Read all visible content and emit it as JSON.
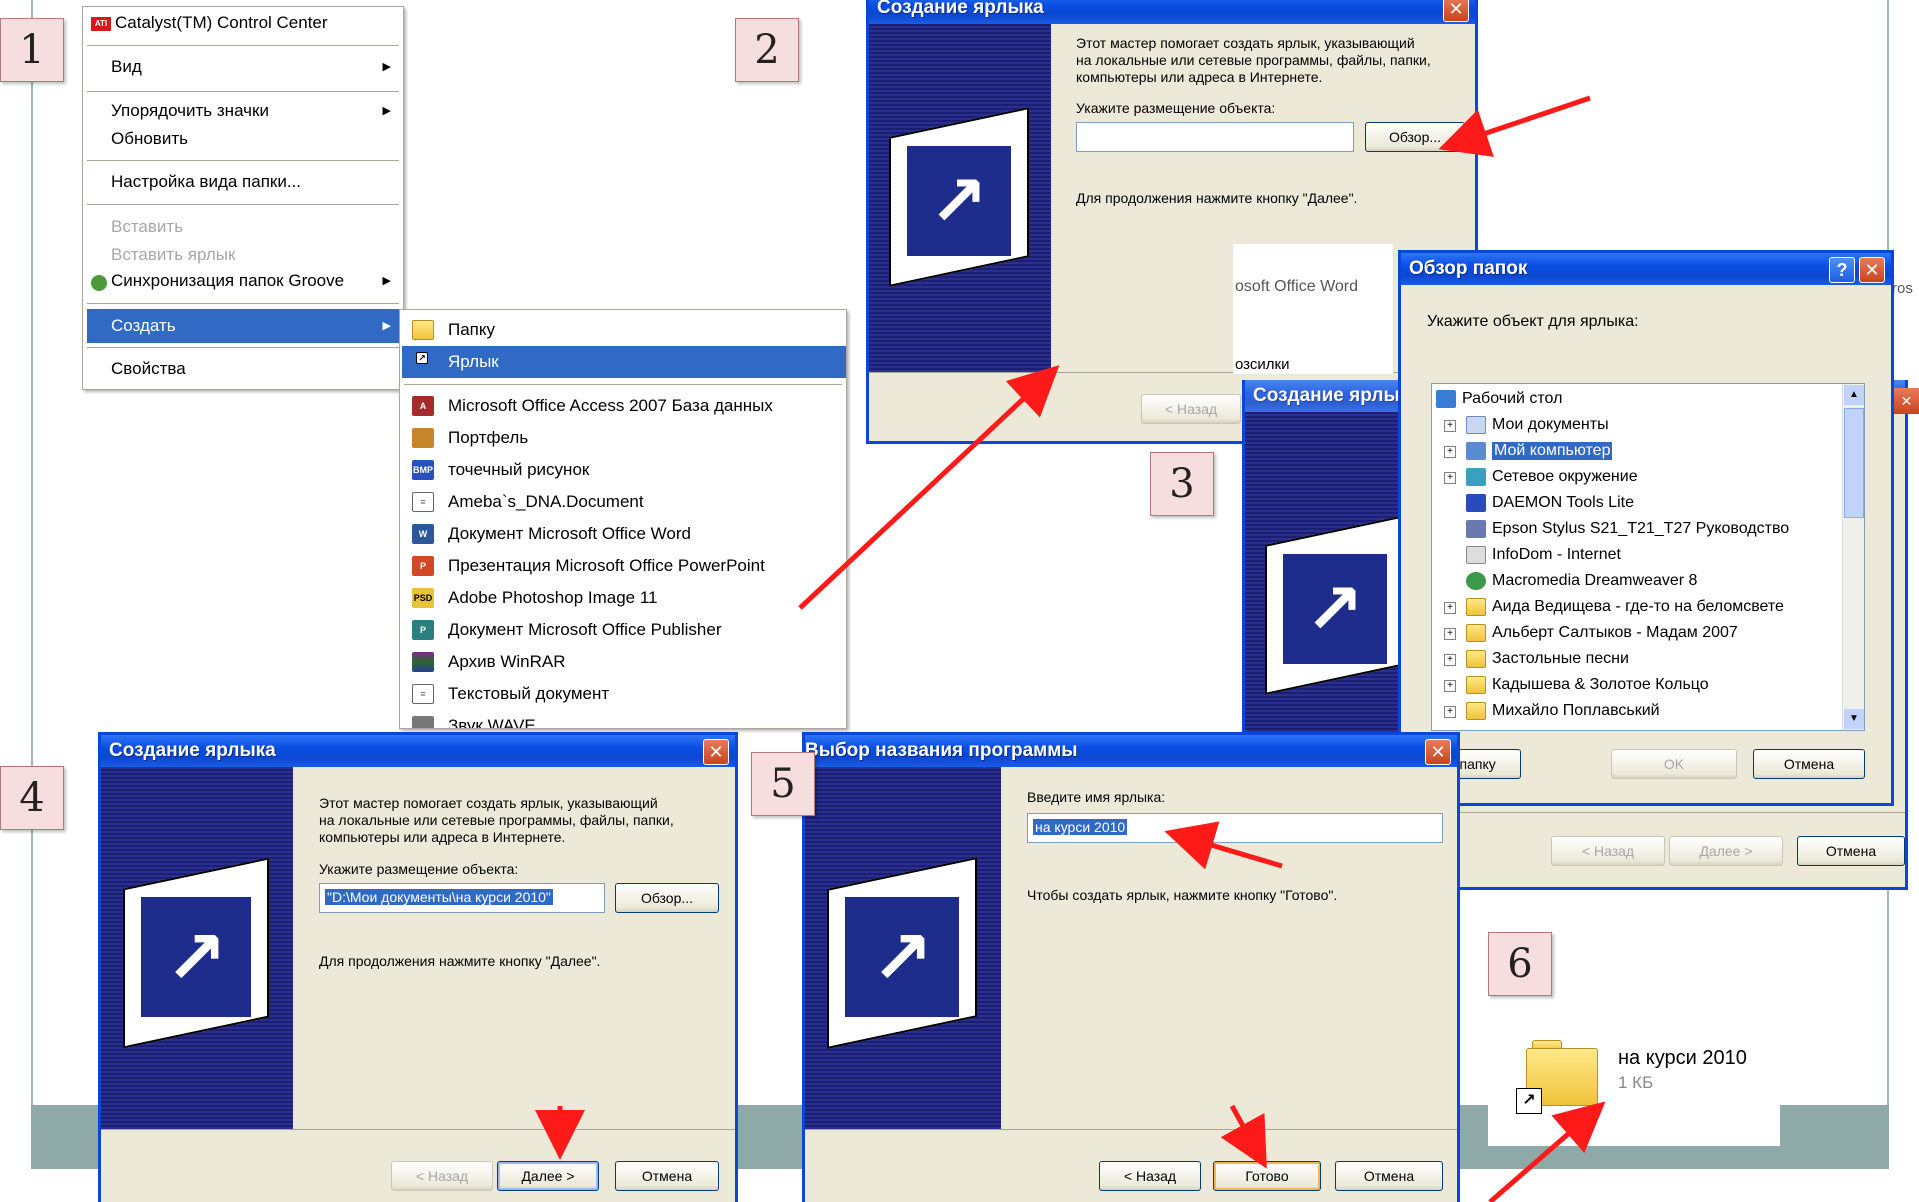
{
  "badges": [
    "1",
    "2",
    "3",
    "4",
    "5",
    "6"
  ],
  "context_menu": {
    "header_item": "Catalyst(TM) Control Center",
    "items": [
      "Вид",
      "Упорядочить значки",
      "Обновить",
      "Настройка вида папки...",
      "Вставить",
      "Вставить ярлык",
      "Синхронизация папок Groove",
      "Создать",
      "Свойства"
    ]
  },
  "create_submenu": {
    "items": [
      "Папку",
      "Ярлык",
      "Microsoft Office Access 2007 База данных",
      "Портфель",
      "точечный рисунок",
      "Ameba`s_DNA.Document",
      "Документ Microsoft Office Word",
      "Презентация Microsoft Office PowerPoint",
      "Adobe Photoshop Image 11",
      "Документ Microsoft Office Publisher",
      "Архив WinRAR",
      "Текстовый документ",
      "Звук WAVE"
    ]
  },
  "wizard_step2": {
    "title": "Создание ярлыка",
    "intro": [
      "Этот мастер помогает создать ярлык, указывающий",
      "на локальные или сетевые программы, файлы, папки,",
      "компьютеры или адреса в Интернете."
    ],
    "location_label": "Укажите размещение объекта:",
    "location_value": "",
    "browse": "Обзор...",
    "continue_hint": "Для продолжения нажмите кнопку \"Далее\".",
    "back": "< Назад"
  },
  "behind_fragments": {
    "word": "osoft Office Word",
    "mail": "озсилки",
    "cut_right": "ros"
  },
  "wizard_step3_behind": {
    "title": "Создание ярлы",
    "back": "< Назад",
    "next": "Далее >",
    "cancel": "Отмена"
  },
  "browse_dialog": {
    "title": "Обзор папок",
    "help": "?",
    "prompt": "Укажите объект для ярлыка:",
    "tree": [
      "Рабочий стол",
      "Мои документы",
      "Мой компьютер",
      "Сетевое окружение",
      "DAEMON Tools Lite",
      "Epson Stylus S21_T21_T27 Руководство",
      "InfoDom - Internet",
      "Macromedia Dreamweaver 8",
      "Аида Ведищева - где-то на беломсвете",
      "Альберт Салтыков - Мадам 2007",
      "Застольные песни",
      "Кадышева & Золотое Кольцо",
      "Михайло Поплавський"
    ],
    "new_folder": "здать папку",
    "ok": "OK",
    "cancel": "Отмена"
  },
  "wizard_step4": {
    "title": "Создание ярлыка",
    "intro": [
      "Этот мастер помогает создать ярлык, указывающий",
      "на локальные или сетевые программы, файлы, папки,",
      "компьютеры или адреса в Интернете."
    ],
    "location_label": "Укажите размещение объекта:",
    "location_value": "\"D:\\Мои документы\\на курси 2010\"",
    "browse": "Обзор...",
    "continue_hint": "Для продолжения нажмите кнопку \"Далее\".",
    "back": "< Назад",
    "next": "Далее >",
    "cancel": "Отмена"
  },
  "wizard_step5": {
    "title": "Выбор названия программы",
    "name_label": "Введите имя ярлыка:",
    "name_value": "на курси 2010",
    "finish_hint": "Чтобы создать ярлык, нажмите кнопку \"Готово\".",
    "back": "< Назад",
    "finish": "Готово",
    "cancel": "Отмена"
  },
  "result_shortcut": {
    "name": "на курси 2010",
    "size": "1 КБ"
  },
  "colors": {
    "arrow": "#ff1a1a",
    "xp_blue": "#0a47d6",
    "selection": "#316ac5",
    "badge_fill": "#f7dede"
  }
}
